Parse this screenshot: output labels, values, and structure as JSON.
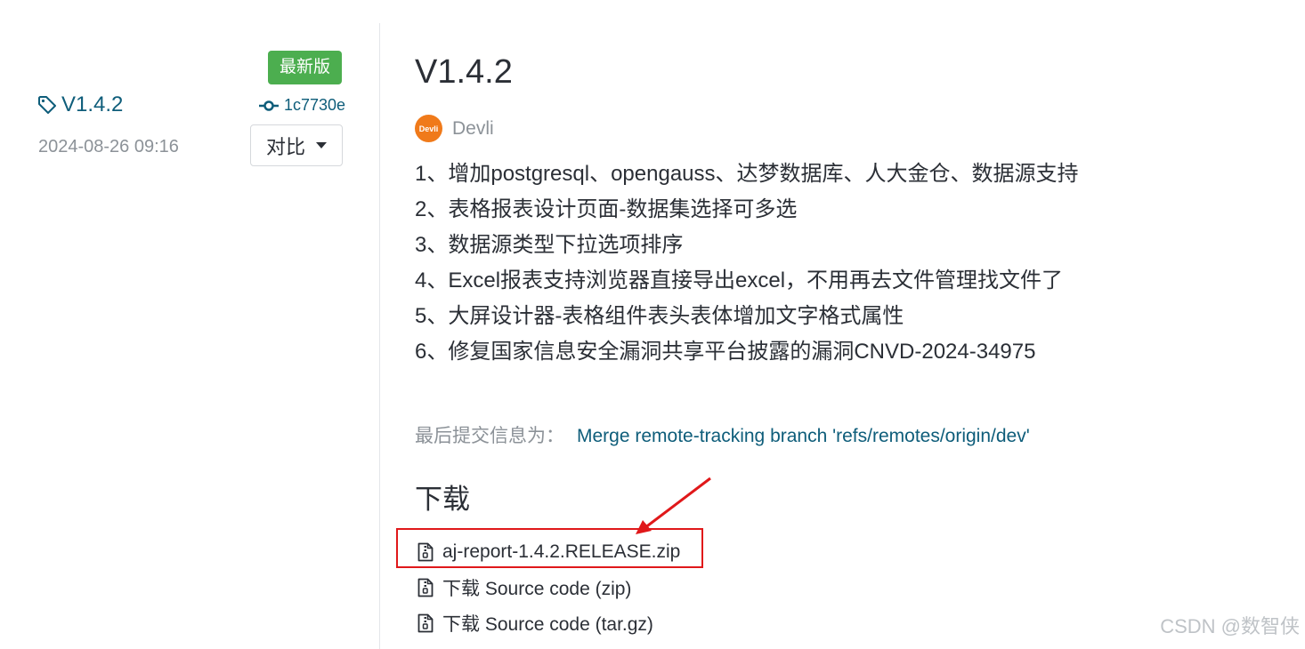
{
  "release_sidebar": {
    "badge": "最新版",
    "tag": "V1.4.2",
    "commit_hash": "1c7730e",
    "date": "2024-08-26 09:16",
    "compare_label": "对比"
  },
  "release": {
    "title": "V1.4.2",
    "avatar_text": "Devli",
    "author": "Devli",
    "notes": [
      "1、增加postgresql、opengauss、达梦数据库、人大金仓、数据源支持",
      "2、表格报表设计页面-数据集选择可多选",
      "3、数据源类型下拉选项排序",
      "4、Excel报表支持浏览器直接导出excel，不用再去文件管理找文件了",
      "5、大屏设计器-表格组件表头表体增加文字格式属性",
      "6、修复国家信息安全漏洞共享平台披露的漏洞CNVD-2024-34975"
    ],
    "last_commit_label": "最后提交信息为：",
    "last_commit_message": "Merge remote-tracking branch 'refs/remotes/origin/dev'",
    "downloads_title": "下载",
    "downloads": [
      "aj-report-1.4.2.RELEASE.zip",
      "下载 Source code (zip)",
      "下载 Source code (tar.gz)"
    ]
  },
  "watermark": "CSDN @数智侠",
  "colors": {
    "badge_green": "#4cae4f",
    "link_teal": "#0e5d7a",
    "annotation_red": "#e0181a",
    "avatar_orange": "#f07a1a"
  }
}
